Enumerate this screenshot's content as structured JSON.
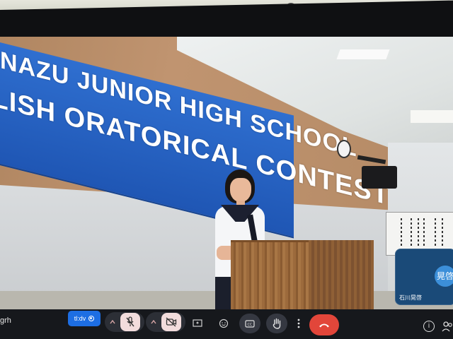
{
  "meeting": {
    "code_label": "grh"
  },
  "video": {
    "banner_line1": "NAZU JUNIOR HIGH SCHOOL",
    "banner_line2": "GLISH ORATORICAL CONTEST"
  },
  "self_tile": {
    "avatar_text": "晃啓",
    "name": "石川晃啓"
  },
  "controls": {
    "captions_pill_label": "tl:dv",
    "mic_state": "muted",
    "camera_state": "off",
    "accent_color": "#1d6ee3",
    "end_call_color": "#e2463a"
  },
  "icons": [
    "chevron-up-icon",
    "mic-off-icon",
    "camera-off-icon",
    "present-icon",
    "emoji-icon",
    "captions-icon",
    "raise-hand-icon",
    "more-options-icon",
    "end-call-icon",
    "info-icon",
    "people-icon"
  ]
}
